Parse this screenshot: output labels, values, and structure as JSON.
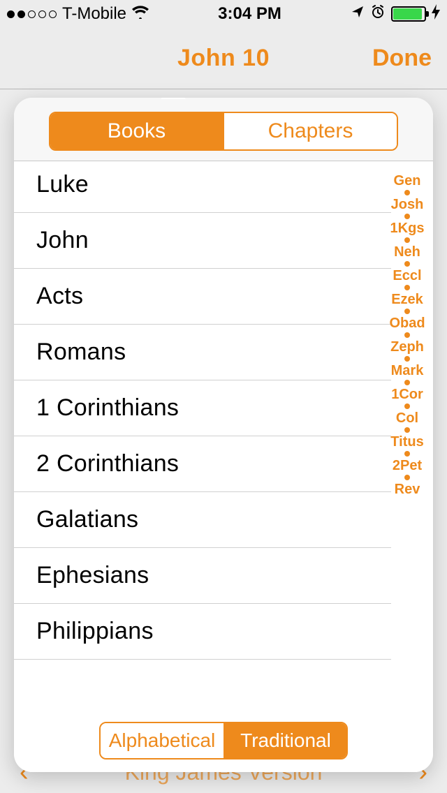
{
  "status": {
    "carrier": "T-Mobile",
    "time": "3:04 PM"
  },
  "nav": {
    "title": "John 10",
    "done": "Done"
  },
  "top_segment": {
    "books": "Books",
    "chapters": "Chapters"
  },
  "books": [
    "Luke",
    "John",
    "Acts",
    "Romans",
    "1 Corinthians",
    "2 Corinthians",
    "Galatians",
    "Ephesians",
    "Philippians"
  ],
  "index_rail": [
    "Gen",
    "Josh",
    "1Kgs",
    "Neh",
    "Eccl",
    "Ezek",
    "Obad",
    "Zeph",
    "Mark",
    "1Cor",
    "Col",
    "Titus",
    "2Pet",
    "Rev"
  ],
  "bottom_segment": {
    "alpha": "Alphabetical",
    "trad": "Traditional"
  },
  "backdrop": {
    "version": "King James Version"
  }
}
